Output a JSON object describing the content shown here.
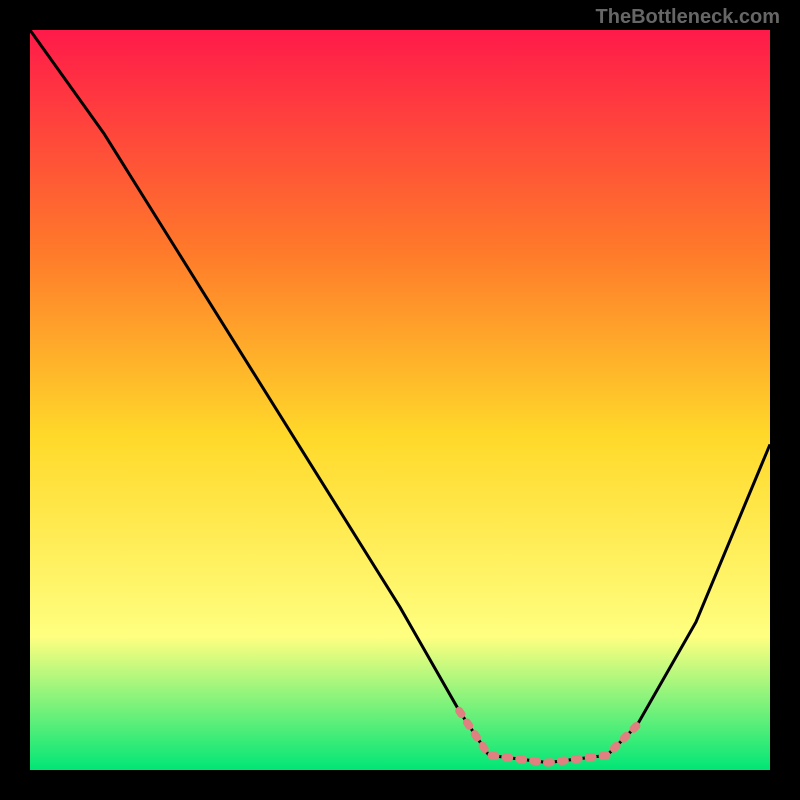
{
  "watermark": "TheBottleneck.com",
  "chart_data": {
    "type": "line",
    "title": "",
    "xlabel": "",
    "ylabel": "",
    "xlim": [
      0,
      100
    ],
    "ylim": [
      0,
      100
    ],
    "gradient_colors": {
      "top": "#ff1a4a",
      "upper_mid": "#ff7a2a",
      "mid": "#ffd92a",
      "lower_mid": "#ffff80",
      "bottom": "#00e676"
    },
    "curve": {
      "description": "Bottleneck-style V curve descending steeply from top-left to a flat minimum then rising to the right edge",
      "points": [
        {
          "x": 0,
          "y": 100
        },
        {
          "x": 10,
          "y": 86
        },
        {
          "x": 20,
          "y": 70
        },
        {
          "x": 30,
          "y": 54
        },
        {
          "x": 40,
          "y": 38
        },
        {
          "x": 50,
          "y": 22
        },
        {
          "x": 58,
          "y": 8
        },
        {
          "x": 62,
          "y": 2
        },
        {
          "x": 70,
          "y": 1
        },
        {
          "x": 78,
          "y": 2
        },
        {
          "x": 82,
          "y": 6
        },
        {
          "x": 90,
          "y": 20
        },
        {
          "x": 100,
          "y": 44
        }
      ]
    },
    "highlight_segment": {
      "color": "#e08080",
      "x_start": 58,
      "x_end": 82,
      "label": "optimal range marker"
    }
  }
}
